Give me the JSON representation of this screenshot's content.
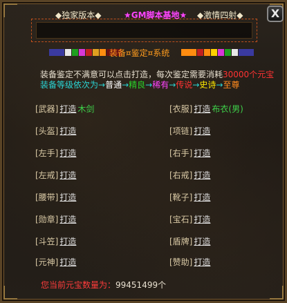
{
  "close_label": "X",
  "nav": {
    "tab1": "◆独家版本◆",
    "tab2": "★GM脚本基地★",
    "tab3": "◆激情四射◆"
  },
  "title": "装备¤鉴定¤系统",
  "swatches_left": [
    "#3a3aa0",
    "#e8e8e8",
    "#1fa01f",
    "#d838d8",
    "#c02020",
    "#e0a020",
    "#ff8c10",
    "#6a1010"
  ],
  "swatches_right": [
    "#ff8c10",
    "#c02020",
    "#ff8c10",
    "#ffd000",
    "#d838d8",
    "#1fa01f",
    "#e8e8e8",
    "#3a3aa0"
  ],
  "desc": {
    "line1_a": "装备鉴定不满意可以点击打造，每次鉴定需要消耗",
    "line1_b": "30000个元宝",
    "line2_a": "装备等级依次为→",
    "line2_q1": "普通",
    "line2_arrow1": "→",
    "line2_q2": "精良",
    "line2_arrow2": "→",
    "line2_q3": "稀有",
    "line2_arrow3": "→",
    "line2_q4": "传说",
    "line2_arrow4": "→",
    "line2_q5": "史诗",
    "line2_arrow5": "→",
    "line2_q6": "至尊"
  },
  "forge_label": "打造",
  "slots_left": [
    {
      "label": "[武器]",
      "item": "木剑"
    },
    {
      "label": "[头盔]",
      "item": ""
    },
    {
      "label": "[左手]",
      "item": ""
    },
    {
      "label": "[左戒]",
      "item": ""
    },
    {
      "label": "[腰带]",
      "item": ""
    },
    {
      "label": "[勋章]",
      "item": ""
    },
    {
      "label": "[斗笠]",
      "item": ""
    },
    {
      "label": "[元神]",
      "item": ""
    }
  ],
  "slots_right": [
    {
      "label": "[衣服]",
      "item": "布衣(男)"
    },
    {
      "label": "[项链]",
      "item": ""
    },
    {
      "label": "[右手]",
      "item": ""
    },
    {
      "label": "[右戒]",
      "item": ""
    },
    {
      "label": "[靴子]",
      "item": ""
    },
    {
      "label": "[宝石]",
      "item": ""
    },
    {
      "label": "[盾牌]",
      "item": ""
    },
    {
      "label": "[赞助]",
      "item": ""
    }
  ],
  "currency": {
    "label": "您当前元宝数量为：",
    "value": "99451499个"
  }
}
